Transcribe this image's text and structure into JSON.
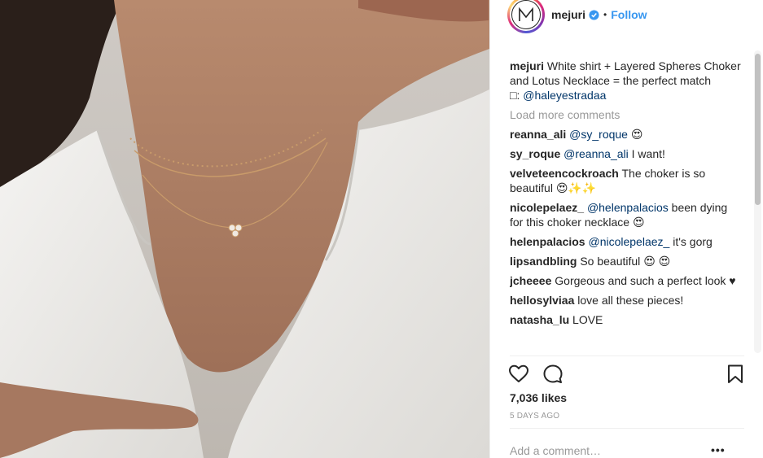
{
  "post": {
    "username": "mejuri",
    "verified_icon": "verified-badge-icon",
    "separator": "•",
    "follow_label": "Follow",
    "avatar_logo": "M",
    "caption": {
      "username": "mejuri",
      "text": "White shirt + Layered Spheres Choker and Lotus Necklace = the perfect match",
      "tag_prefix": "□:",
      "tag_mention": "@haleyestradaa"
    },
    "load_more": "Load more comments",
    "comments": [
      {
        "user": "reanna_ali",
        "mention": "@sy_roque",
        "text": "",
        "emoji": "😍"
      },
      {
        "user": "sy_roque",
        "mention": "@reanna_ali",
        "text": "I want!",
        "emoji": ""
      },
      {
        "user": "velveteencockroach",
        "mention": "",
        "text": "The choker is so beautiful",
        "emoji": "😍✨✨"
      },
      {
        "user": "nicolepelaez_",
        "mention": "@helenpalacios",
        "text": "been dying for this choker necklace",
        "emoji": "😍"
      },
      {
        "user": "helenpalacios",
        "mention": "@nicolepelaez_",
        "text": "it's gorg",
        "emoji": ""
      },
      {
        "user": "lipsandbling",
        "mention": "",
        "text": "So beautiful",
        "emoji": "😍 😍"
      },
      {
        "user": "jcheeee",
        "mention": "",
        "text": "Gorgeous and such a perfect look ♥",
        "emoji": ""
      },
      {
        "user": "hellosylviaa",
        "mention": "",
        "text": "love all these pieces!",
        "emoji": ""
      },
      {
        "user": "natasha_lu",
        "mention": "",
        "text": "LOVE",
        "emoji": ""
      }
    ],
    "actions": {
      "like_icon": "heart-icon",
      "comment_icon": "comment-icon",
      "save_icon": "bookmark-icon"
    },
    "likes": "7,036 likes",
    "date": "5 DAYS AGO",
    "add_comment_placeholder": "Add a comment…",
    "more_options": "•••",
    "colors": {
      "link_blue": "#3897f0",
      "mention_blue": "#003569",
      "muted_gray": "#999999",
      "text": "#262626"
    }
  }
}
